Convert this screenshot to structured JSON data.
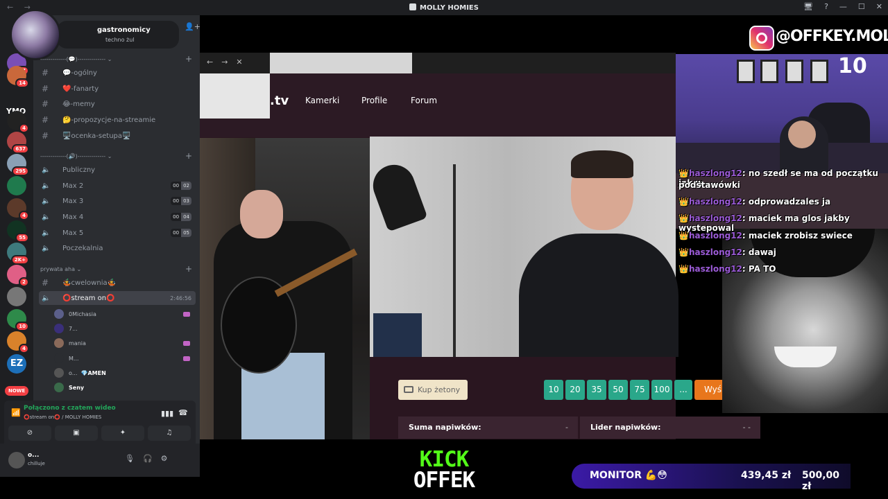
{
  "window": {
    "title": "MOLLY HOMIES",
    "nav": "← →",
    "controls": [
      "🖥",
      "?",
      "—",
      "☐",
      "✕"
    ]
  },
  "server_rail": {
    "badges": [
      "27",
      "14",
      "4",
      "637",
      "295",
      "4",
      "55",
      "2K+",
      "2",
      "10",
      "4"
    ],
    "ymo_label": "YMO",
    "ez_label": "EZ",
    "new_label": "NOWE"
  },
  "server_header": {
    "name": "gastronomicy",
    "subtitle": "techno żul"
  },
  "categories": {
    "text": "-------------(💬)-------------- ⌄",
    "voice": "-------------(🔊)-------------- ⌄",
    "private": "prywata aha ⌄"
  },
  "text_channels": [
    {
      "label": "💬-ogólny"
    },
    {
      "label": "❤️-fanarty"
    },
    {
      "label": "😂-memy"
    },
    {
      "label": "🤔-propozycje-na-streamie"
    },
    {
      "label": "🖥️ocenka-setupa🖥️"
    }
  ],
  "voice_channels": [
    {
      "label": "Publiczny"
    },
    {
      "label": "Max 2",
      "count": "00",
      "limit": "02"
    },
    {
      "label": "Max 3",
      "count": "00",
      "limit": "03"
    },
    {
      "label": "Max 4",
      "count": "00",
      "limit": "04"
    },
    {
      "label": "Max 5",
      "count": "00",
      "limit": "05"
    },
    {
      "label": "Poczekalnia"
    }
  ],
  "private_channels": {
    "text": "🤹cwelownia🤹",
    "stream": "⭕stream on⭕",
    "stream_timer": "2:46:56"
  },
  "voice_users": [
    {
      "name": "0Michasia",
      "status": ""
    },
    {
      "name": "7...",
      "status": ""
    },
    {
      "name": "mania",
      "status": ""
    },
    {
      "name": "M...",
      "status": ""
    },
    {
      "name": "o...",
      "status": "💎AMEN"
    },
    {
      "name": "Seny",
      "status": ""
    }
  ],
  "voice_panel": {
    "title": "Połączono z czatem wideo",
    "subtitle": "⭕stream on⭕ / MOLLY HOMIES"
  },
  "user_panel": {
    "name": "o...",
    "status": "chilluje"
  },
  "browser": {
    "site_suffix": ".tv",
    "nav": [
      "Kamerki",
      "Profile",
      "Forum"
    ],
    "buy_tokens": "Kup żetony",
    "tip_amounts": [
      "10",
      "20",
      "35",
      "50",
      "75",
      "100",
      "..."
    ],
    "send": "Wyśl",
    "tips_sum_label": "Suma napiwków:",
    "tips_sum_value": "-",
    "tips_leader_label": "Lider napiwków:",
    "tips_leader_value": "-  -"
  },
  "overlay": {
    "instagram": "@OFFKEY.MOLLY",
    "webcam_number": "10",
    "chat": [
      {
        "user": "haszlong12",
        "msg": "no szedł se ma od początku jak w"
      },
      {
        "user": "",
        "msg": "podstawówki"
      },
      {
        "user": "haszlong12",
        "msg": "odprowadzales ja"
      },
      {
        "user": "haszlong12",
        "msg": "maciek ma glos jakby wystepowal"
      },
      {
        "user": "haszlong12",
        "msg": "maciek zrobisz swiece"
      },
      {
        "user": "haszlong12",
        "msg": "dawaj"
      },
      {
        "user": "haszlong12",
        "msg": "PA TO"
      }
    ],
    "kick_top": "KICK",
    "kick_bottom": "OFFEK",
    "monitor_label": "MONITOR 💪😳",
    "monitor_amount": "439,45 zł",
    "monitor_goal": "500,00 zł"
  },
  "colors": {
    "discord_bg": "#2b2d31",
    "rail_bg": "#1e1f22",
    "kick_green": "#53fc18",
    "tip_teal": "#2aa78a",
    "send_orange": "#e8761c"
  }
}
